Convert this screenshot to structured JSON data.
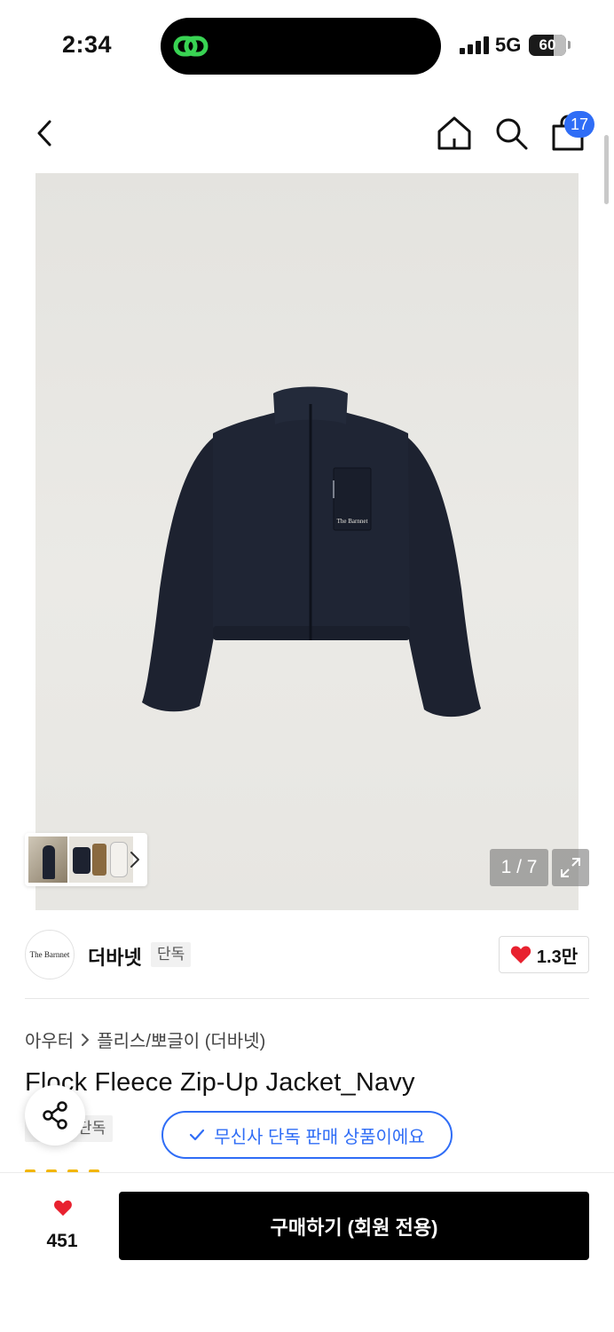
{
  "status_bar": {
    "time": "2:34",
    "network": "5G",
    "battery": "60"
  },
  "nav": {
    "cart_count": "17"
  },
  "gallery": {
    "counter": "1 / 7",
    "logo_text": "The Barnnet"
  },
  "brand": {
    "logo_text": "The Barnnet",
    "name": "더바넷",
    "badge": "단독",
    "likes": "1.3만"
  },
  "breadcrumb": {
    "category": "아우터",
    "subcategory": "플리스/뽀글이 (더바넷)"
  },
  "product": {
    "title": "Flock Fleece Zip-Up Jacket_Navy",
    "tag": "단독",
    "exclusive_notice": "무신사 단독 판매 상품이에요"
  },
  "bottom": {
    "wish_count": "451",
    "buy_label": "구매하기 (회원 전용)"
  },
  "colors": {
    "accent": "#2f6df6",
    "heart": "#e8212f",
    "buy_button": "#000000",
    "jacket": "#1d2230"
  },
  "icons": [
    "back-icon",
    "home-icon",
    "search-icon",
    "shopping-bag-icon",
    "chevron-right-icon",
    "expand-icon",
    "heart-icon",
    "share-icon",
    "check-icon"
  ]
}
